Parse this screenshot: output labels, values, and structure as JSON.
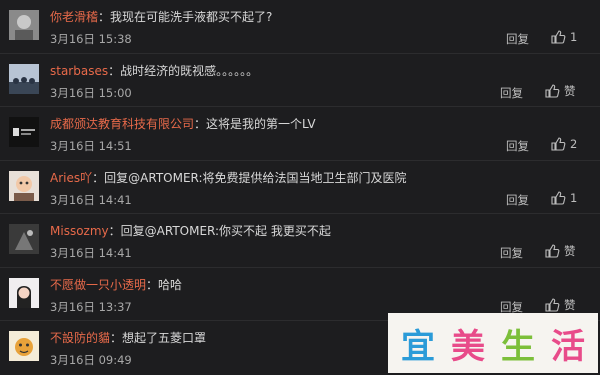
{
  "comments": [
    {
      "username": "你老滑稽",
      "sep": "：",
      "text": "我现在可能洗手液都买不起了?",
      "time": "3月16日 15:38",
      "reply": "回复",
      "likes": "1"
    },
    {
      "username": "starbases",
      "sep": "：",
      "text": "战时经济的既视感。。。。。。",
      "time": "3月16日 15:00",
      "reply": "回复",
      "likes": "赞"
    },
    {
      "username": "成都颁达教育科技有限公司",
      "sep": "：",
      "text": "这将是我的第一个LV",
      "time": "3月16日 14:51",
      "reply": "回复",
      "likes": "2"
    },
    {
      "username": "Aries吖",
      "sep": "：",
      "prefix": "回复",
      "mention": "@ARTOMER",
      "text": ":将免费提供给法国当地卫生部门及医院",
      "time": "3月16日 14:41",
      "reply": "回复",
      "likes": "1"
    },
    {
      "username": "Missozmy",
      "sep": "：",
      "prefix": "回复",
      "mention": "@ARTOMER",
      "text": ":你买不起 我更买不起",
      "time": "3月16日 14:41",
      "reply": "回复",
      "likes": "赞"
    },
    {
      "username": "不愿做一只小透明",
      "sep": "：",
      "text": "哈哈",
      "time": "3月16日 13:37",
      "reply": "回复",
      "likes": "赞"
    },
    {
      "username": "不設防的貓",
      "sep": "：",
      "text": "想起了五菱口罩",
      "time": "3月16日 09:49",
      "reply": "回复",
      "likes": "赞"
    }
  ],
  "watermark": {
    "chars": [
      "宜",
      "美",
      "生",
      "活"
    ]
  },
  "colors": {
    "username": "#e86a4a",
    "background": "#1d1d1f"
  }
}
